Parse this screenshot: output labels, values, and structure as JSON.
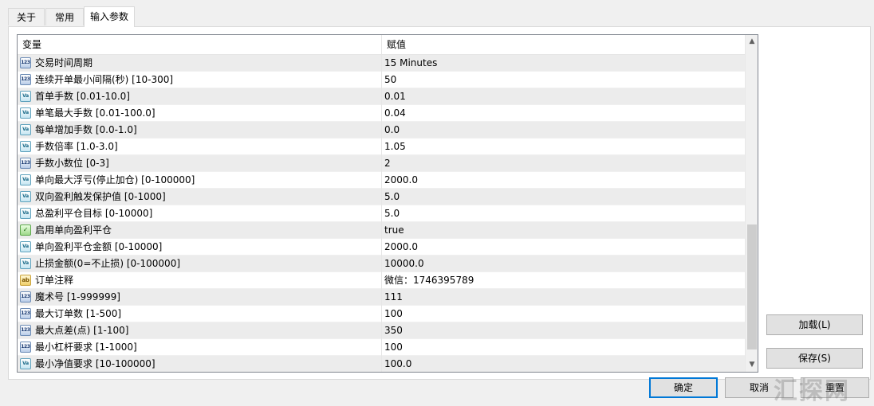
{
  "tabs": [
    {
      "label": "关于",
      "active": false
    },
    {
      "label": "常用",
      "active": false
    },
    {
      "label": "输入参数",
      "active": true
    }
  ],
  "grid": {
    "header": {
      "variable": "变量",
      "value": "赋值"
    },
    "rows": [
      {
        "icon": "int-type-icon",
        "type": "int",
        "name": "交易时间周期",
        "value": "15 Minutes"
      },
      {
        "icon": "int-type-icon",
        "type": "int",
        "name": "连续开单最小间隔(秒) [10-300]",
        "value": "50"
      },
      {
        "icon": "double-type-icon",
        "type": "dbl",
        "name": "首单手数 [0.01-10.0]",
        "value": "0.01"
      },
      {
        "icon": "double-type-icon",
        "type": "dbl",
        "name": "单笔最大手数 [0.01-100.0]",
        "value": "0.04"
      },
      {
        "icon": "double-type-icon",
        "type": "dbl",
        "name": "每单增加手数 [0.0-1.0]",
        "value": "0.0"
      },
      {
        "icon": "double-type-icon",
        "type": "dbl",
        "name": "手数倍率 [1.0-3.0]",
        "value": "1.05"
      },
      {
        "icon": "int-type-icon",
        "type": "int",
        "name": "手数小数位 [0-3]",
        "value": "2"
      },
      {
        "icon": "double-type-icon",
        "type": "dbl",
        "name": "单向最大浮亏(停止加仓) [0-100000]",
        "value": "2000.0"
      },
      {
        "icon": "double-type-icon",
        "type": "dbl",
        "name": "双向盈利触发保护值 [0-1000]",
        "value": "5.0"
      },
      {
        "icon": "double-type-icon",
        "type": "dbl",
        "name": "总盈利平仓目标 [0-10000]",
        "value": "5.0"
      },
      {
        "icon": "bool-type-icon",
        "type": "bool",
        "name": "启用单向盈利平仓",
        "value": "true"
      },
      {
        "icon": "double-type-icon",
        "type": "dbl",
        "name": "单向盈利平仓金额 [0-10000]",
        "value": "2000.0"
      },
      {
        "icon": "double-type-icon",
        "type": "dbl",
        "name": "止损金额(0=不止损) [0-100000]",
        "value": "10000.0"
      },
      {
        "icon": "string-type-icon",
        "type": "str",
        "name": "订单注释",
        "value": "微信：1746395789"
      },
      {
        "icon": "int-type-icon",
        "type": "int",
        "name": "魔术号 [1-999999]",
        "value": "111"
      },
      {
        "icon": "int-type-icon",
        "type": "int",
        "name": "最大订单数 [1-500]",
        "value": "100"
      },
      {
        "icon": "int-type-icon",
        "type": "int",
        "name": "最大点差(点) [1-100]",
        "value": "350"
      },
      {
        "icon": "int-type-icon",
        "type": "int",
        "name": "最小杠杆要求 [1-1000]",
        "value": "100"
      },
      {
        "icon": "double-type-icon",
        "type": "dbl",
        "name": "最小净值要求 [10-100000]",
        "value": "100.0"
      }
    ],
    "icon_glyphs": {
      "int": "123",
      "dbl": "Va",
      "bool": "✓",
      "str": "ab"
    }
  },
  "buttons": {
    "load": "加载(L)",
    "save": "保存(S)",
    "ok": "确定",
    "cancel": "取消",
    "reset": "重置"
  },
  "watermark": "汇探网",
  "colors": {
    "selected_border": "#0078d7",
    "row_alt": "#ececec"
  }
}
